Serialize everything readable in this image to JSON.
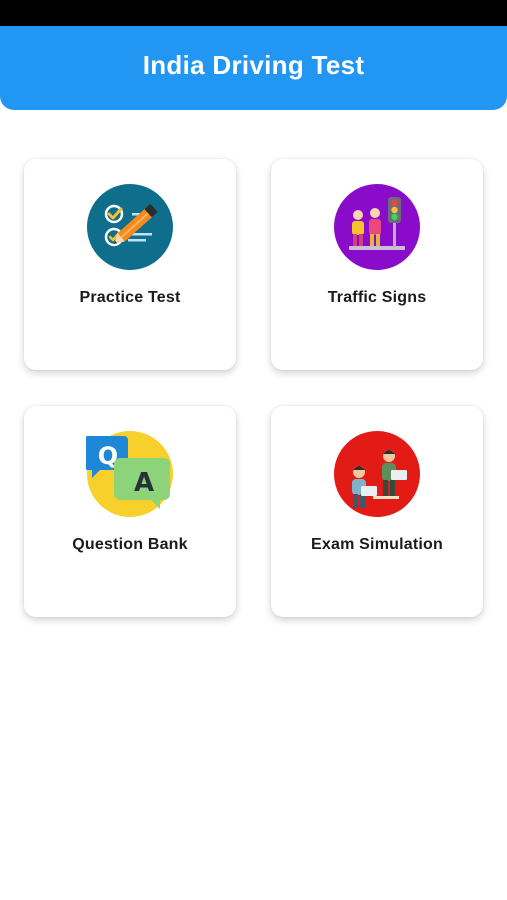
{
  "header": {
    "title": "India Driving Test",
    "color": "#2196F3"
  },
  "menu": {
    "items": [
      {
        "label": "Practice Test",
        "icon": "checklist-pencil-icon"
      },
      {
        "label": "Traffic Signs",
        "icon": "traffic-light-people-icon"
      },
      {
        "label": "Question Bank",
        "icon": "qa-speech-bubbles-icon"
      },
      {
        "label": "Exam Simulation",
        "icon": "students-exam-icon"
      }
    ]
  }
}
